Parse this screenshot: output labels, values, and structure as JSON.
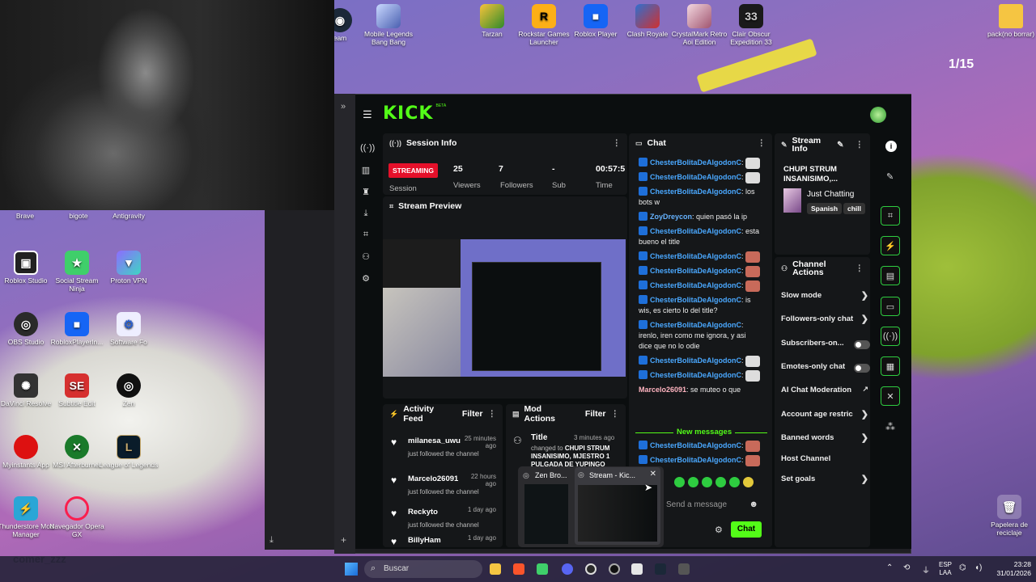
{
  "webcam": {
    "label": "comer_zzz"
  },
  "desktop_top_icons": [
    {
      "label": "eam"
    },
    {
      "label": "Mobile Legends Bang Bang"
    },
    {
      "label": "Tarzan"
    },
    {
      "label": "Rockstar Games Launcher"
    },
    {
      "label": "Roblox Player"
    },
    {
      "label": "Clash Royale"
    },
    {
      "label": "CrystalMark Retro Aoi Edition"
    },
    {
      "label": "Clair Obscur Expedition 33"
    },
    {
      "label": "pack(no borrar)"
    }
  ],
  "desktop_left_icons": [
    {
      "label": "Brave"
    },
    {
      "label": "bigote"
    },
    {
      "label": "Antigravity"
    },
    {
      "label": "Roblox Studio"
    },
    {
      "label": "Social Stream Ninja"
    },
    {
      "label": "Proton VPN"
    },
    {
      "label": "OBS Studio"
    },
    {
      "label": "RobloxPlayerIn..."
    },
    {
      "label": "Software Fo"
    },
    {
      "label": "DaVinci Resolve"
    },
    {
      "label": "Subtitle Edit"
    },
    {
      "label": "Zen"
    },
    {
      "label": "Myinstants App"
    },
    {
      "label": "MSI Afterburner"
    },
    {
      "label": "League of Legends"
    },
    {
      "label": "Thunderstore Mod Manager"
    },
    {
      "label": "Navegador Opera GX"
    }
  ],
  "recycle_bin": {
    "label": "Papelera de reciclaje"
  },
  "slide_counter": "1/15",
  "kick": {
    "logo": "KICK",
    "beta": "BETA",
    "session_info": {
      "title": "Session Info",
      "status": "STREAMING",
      "viewers_value": "25",
      "followers_value": "7",
      "sub_value": "-",
      "time_value": "00:57:5",
      "session_label": "Session",
      "viewers_label": "Viewers",
      "followers_label": "Followers",
      "sub_label": "Sub",
      "time_label": "Time"
    },
    "stream_preview": {
      "title": "Stream Preview"
    },
    "chat": {
      "title": "Chat",
      "messages": [
        {
          "user": "ChesterBolitaDeAlgodonC",
          "text": ":"
        },
        {
          "user": "ChesterBolitaDeAlgodonC",
          "text": ":"
        },
        {
          "user": "ChesterBolitaDeAlgodonC",
          "text": ": los bots w"
        },
        {
          "user": "ZoyDreycon",
          "text": ": quien pasó la ip"
        },
        {
          "user": "ChesterBolitaDeAlgodonC",
          "text": ": esta bueno el title"
        },
        {
          "user": "ChesterBolitaDeAlgodonC",
          "text": ":"
        },
        {
          "user": "ChesterBolitaDeAlgodonC",
          "text": ":"
        },
        {
          "user": "ChesterBolitaDeAlgodonC",
          "text": ":"
        },
        {
          "user": "ChesterBolitaDeAlgodonC",
          "text": ": is wis, es cierto lo del title?"
        },
        {
          "user": "ChesterBolitaDeAlgodonC",
          "text": ": irenlo, iren como me ignora, y asi dice que no lo odie"
        },
        {
          "user": "ChesterBolitaDeAlgodonC",
          "text": ":"
        },
        {
          "user": "ChesterBolitaDeAlgodonC",
          "text": ":"
        },
        {
          "user": "Marcelo26091",
          "text": ": se muteo o que"
        }
      ],
      "new_messages_label": "New messages",
      "new_messages": [
        {
          "user": "ChesterBolitaDeAlgodonC",
          "text": ":"
        },
        {
          "user": "ChesterBolitaDeAlgodonC",
          "text": ":"
        }
      ],
      "input_placeholder": "Send a message",
      "send_label": "Chat"
    },
    "stream_info": {
      "title": "Stream Info",
      "stream_title": "CHUPI STRUM INSANISIMO,...",
      "category": "Just Chatting",
      "tags": [
        "Spanish",
        "chill"
      ]
    },
    "channel_actions": {
      "title": "Channel Actions",
      "items": [
        {
          "label": "Slow mode",
          "kind": "arrow"
        },
        {
          "label": "Followers-only chat",
          "kind": "arrow"
        },
        {
          "label": "Subscribers-on...",
          "kind": "toggle"
        },
        {
          "label": "Emotes-only chat",
          "kind": "toggle"
        },
        {
          "label": "AI Chat Moderation",
          "kind": "link"
        },
        {
          "label": "Account age restric",
          "kind": "arrow"
        },
        {
          "label": "Banned words",
          "kind": "arrow"
        },
        {
          "label": "Host Channel",
          "kind": "none"
        },
        {
          "label": "Set goals",
          "kind": "arrow"
        }
      ]
    },
    "activity_feed": {
      "title": "Activity Feed",
      "filter_label": "Filter",
      "items": [
        {
          "user": "milanesa_uwu",
          "time": "25 minutes ago",
          "action": "just followed the channel"
        },
        {
          "user": "Marcelo26091",
          "time": "22 hours ago",
          "action": "just followed the channel"
        },
        {
          "user": "Reckyto",
          "time": "1 day ago",
          "action": "just followed the channel"
        },
        {
          "user": "BillyHam",
          "time": "1 day ago",
          "action": ""
        }
      ]
    },
    "mod_actions": {
      "title": "Mod Actions",
      "filter_label": "Filter",
      "item_title": "Title",
      "item_time": "3 minutes ago",
      "item_text_prefix": "changed to",
      "item_text": "CHUPI STRUM INSANISIMO, MJESTRO 1 PULGADA DE YUPINGO"
    }
  },
  "taskbar_previews": [
    {
      "label": "Zen Bro..."
    },
    {
      "label": "Stream - Kic..."
    }
  ],
  "taskbar": {
    "search_placeholder": "Buscar",
    "lang_line1": "ESP",
    "lang_line2": "LAA",
    "time": "23:28",
    "date": "31/01/2026"
  },
  "colors": {
    "kick_green": "#53fc18",
    "streaming_red": "#e5102a",
    "chat_user_blue": "#4aa8ff"
  }
}
